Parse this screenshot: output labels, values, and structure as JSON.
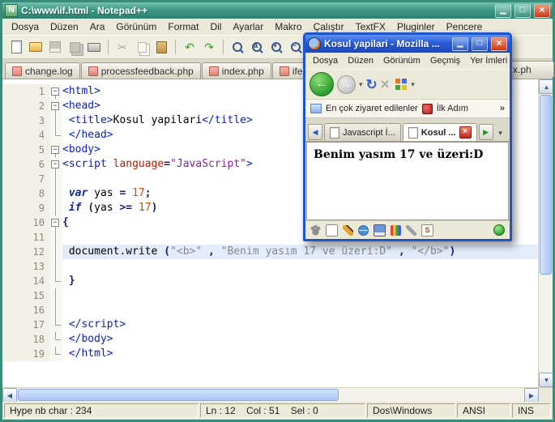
{
  "notepad": {
    "window_title": "C:\\www\\if.html - Notepad++",
    "menus": [
      "Dosya",
      "Düzen",
      "Ara",
      "Görünüm",
      "Format",
      "Dil",
      "Ayarlar",
      "Makro",
      "Çalıştır",
      "TextFX",
      "Pluginler",
      "Pencere"
    ],
    "toolbar": [
      {
        "name": "new-file-icon",
        "icon": "page"
      },
      {
        "name": "open-folder-icon",
        "icon": "folder"
      },
      {
        "name": "save-icon",
        "icon": "disk",
        "disabled": true
      },
      {
        "name": "save-all-icon",
        "icon": "disks",
        "disabled": true
      },
      {
        "name": "print-icon",
        "icon": "printer"
      },
      {
        "name": "separator"
      },
      {
        "name": "cut-icon",
        "glyph": "✂",
        "color": "#555555",
        "disabled": true
      },
      {
        "name": "copy-icon",
        "icon": "pages",
        "disabled": true
      },
      {
        "name": "paste-icon",
        "icon": "clipboard"
      },
      {
        "name": "separator"
      },
      {
        "name": "undo-icon",
        "glyph": "↶",
        "color": "#2e9e2e"
      },
      {
        "name": "redo-icon",
        "glyph": "↷",
        "color": "#2e9e2e"
      },
      {
        "name": "separator"
      },
      {
        "name": "find-icon",
        "icon": "mag"
      },
      {
        "name": "replace-icon",
        "icon": "mag2"
      },
      {
        "name": "zoom-in-icon",
        "icon": "magp"
      },
      {
        "name": "zoom-out-icon",
        "icon": "magm"
      },
      {
        "name": "separator"
      },
      {
        "name": "word-wrap-icon",
        "glyph": "¶",
        "color": "#3858c0"
      },
      {
        "name": "show-symbols-icon",
        "glyph": "¶",
        "color": "#9a9ab0"
      },
      {
        "name": "record-macro-icon",
        "glyph": "●",
        "color": "#c2c2c2"
      },
      {
        "name": "play-macro-icon",
        "glyph": "▶",
        "color": "#c2c2c2"
      }
    ],
    "tabs": [
      "change.log",
      "processfeedback.php",
      "index.php",
      "ifelse.php"
    ],
    "partial_tab": "x.ph",
    "editor": {
      "lines": [
        {
          "n": 1,
          "fold": "box",
          "seg": [
            [
              "tag",
              "<html>"
            ]
          ]
        },
        {
          "n": 2,
          "fold": "box",
          "seg": [
            [
              "tag",
              "<head>"
            ]
          ]
        },
        {
          "n": 3,
          "fold": "v",
          "seg": [
            [
              "plain",
              " "
            ],
            [
              "tag",
              "<title>"
            ],
            [
              "plain",
              "Kosul yapilari"
            ],
            [
              "tag",
              "</title>"
            ]
          ]
        },
        {
          "n": 4,
          "fold": "end",
          "seg": [
            [
              "plain",
              " "
            ],
            [
              "tag",
              "</head>"
            ]
          ]
        },
        {
          "n": 5,
          "fold": "box",
          "seg": [
            [
              "tag",
              "<body>"
            ]
          ]
        },
        {
          "n": 6,
          "fold": "box",
          "seg": [
            [
              "tag",
              "<script "
            ],
            [
              "attr",
              "language"
            ],
            [
              "op",
              "="
            ],
            [
              "val",
              "\"JavaScript\""
            ],
            [
              "tag",
              ">"
            ]
          ]
        },
        {
          "n": 7,
          "fold": "v",
          "seg": []
        },
        {
          "n": 8,
          "fold": "v",
          "seg": [
            [
              "plain",
              " "
            ],
            [
              "kw",
              "var"
            ],
            [
              "plain",
              " yas "
            ],
            [
              "op",
              "="
            ],
            [
              "plain",
              " "
            ],
            [
              "num",
              "17"
            ],
            [
              "op",
              ";"
            ]
          ]
        },
        {
          "n": 9,
          "fold": "v",
          "seg": [
            [
              "plain",
              " "
            ],
            [
              "kw",
              "if"
            ],
            [
              "plain",
              " "
            ],
            [
              "op",
              "("
            ],
            [
              "plain",
              "yas "
            ],
            [
              "op",
              ">="
            ],
            [
              "plain",
              " "
            ],
            [
              "num",
              "17"
            ],
            [
              "op",
              ")"
            ]
          ]
        },
        {
          "n": 10,
          "fold": "box",
          "seg": [
            [
              "op",
              "{"
            ]
          ]
        },
        {
          "n": 11,
          "fold": "v",
          "seg": []
        },
        {
          "n": 12,
          "fold": "v",
          "cur": true,
          "seg": [
            [
              "plain",
              " document.write "
            ],
            [
              "op",
              "("
            ],
            [
              "str",
              "\"<b>\""
            ],
            [
              "plain",
              " "
            ],
            [
              "op",
              ","
            ],
            [
              "plain",
              " "
            ],
            [
              "str",
              "\"Benim yasım 17 ve üzeri:D\""
            ],
            [
              "plain",
              " "
            ],
            [
              "op",
              ","
            ],
            [
              "plain",
              " "
            ],
            [
              "str",
              "\"</b>\""
            ],
            [
              "op",
              ")"
            ]
          ]
        },
        {
          "n": 13,
          "fold": "v",
          "seg": []
        },
        {
          "n": 14,
          "fold": "end",
          "seg": [
            [
              "plain",
              " "
            ],
            [
              "op",
              "}"
            ]
          ]
        },
        {
          "n": 15,
          "fold": "v",
          "seg": []
        },
        {
          "n": 16,
          "fold": "v",
          "seg": []
        },
        {
          "n": 17,
          "fold": "end",
          "seg": [
            [
              "plain",
              " "
            ],
            [
              "tag",
              "</script>"
            ]
          ]
        },
        {
          "n": 18,
          "fold": "end",
          "seg": [
            [
              "plain",
              " "
            ],
            [
              "tag",
              "</body>"
            ]
          ]
        },
        {
          "n": 19,
          "fold": "end",
          "seg": [
            [
              "plain",
              " "
            ],
            [
              "tag",
              "</html>"
            ]
          ]
        }
      ]
    },
    "status": {
      "left": "Hype nb char : 234",
      "position": "Ln : 12    Col : 51    Sel : 0",
      "eol": "Dos\\Windows",
      "encoding": "ANSI",
      "mode": "INS"
    }
  },
  "firefox": {
    "window_title": "Kosul yapilari - Mozilla ...",
    "menus": [
      "Dosya",
      "Düzen",
      "Görünüm",
      "Geçmiş",
      "Yer İmleri"
    ],
    "bookmarks": {
      "most_visited": "En çok ziyaret edilenler",
      "ilk_adim": "İlk Adım",
      "overflow": "»"
    },
    "tabs": {
      "tab1": "Javascript İ...",
      "tab2": "Kosul ..."
    },
    "content_text": "Benim yasım 17 ve üzeri:D",
    "addon_icons": [
      "paw-icon",
      "document-icon",
      "pencil-icon",
      "globe-icon",
      "disk-icon",
      "palette-icon",
      "wrench-icon",
      "script-icon"
    ]
  }
}
